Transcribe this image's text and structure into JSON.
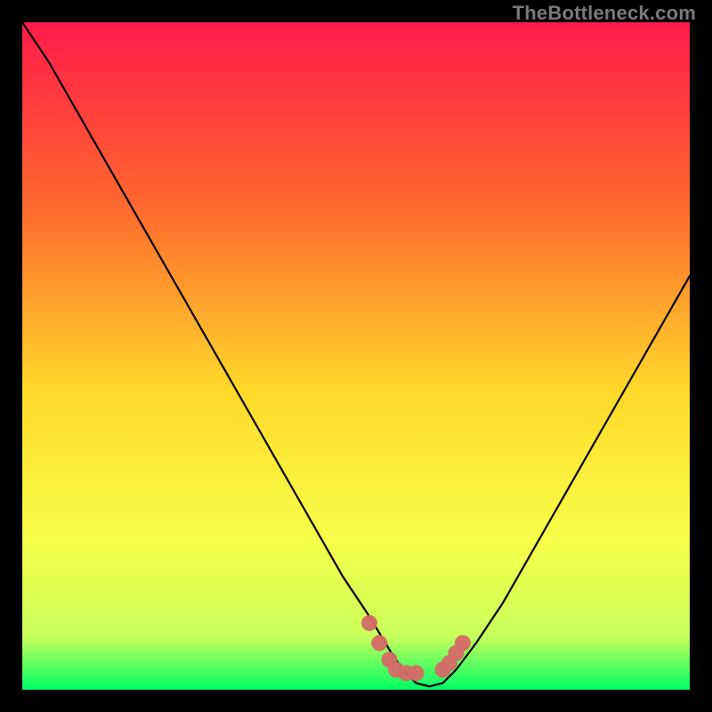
{
  "watermark": "TheBottleneck.com",
  "colors": {
    "background": "#000000",
    "gradient_top": "#ff1a4a",
    "gradient_mid_upper": "#ff8b2a",
    "gradient_mid": "#ffd82a",
    "gradient_mid_lower": "#f7ff4a",
    "gradient_lower": "#c8ff5a",
    "gradient_bottom": "#00ff66",
    "curve": "#000000",
    "marker": "#d46a66"
  },
  "chart_data": {
    "type": "line",
    "title": "",
    "xlabel": "",
    "ylabel": "",
    "xlim": [
      0,
      100
    ],
    "ylim": [
      0,
      100
    ],
    "series": [
      {
        "name": "bottleneck-curve",
        "x": [
          0,
          4,
          8,
          12,
          16,
          20,
          24,
          28,
          32,
          36,
          40,
          44,
          48,
          52,
          55,
          57,
          59,
          61,
          63,
          65,
          68,
          72,
          76,
          80,
          84,
          88,
          92,
          96,
          100
        ],
        "values": [
          100,
          94,
          87,
          80,
          73,
          66,
          59,
          52,
          45,
          38,
          31,
          24,
          17,
          11,
          6,
          3,
          1,
          0.5,
          1,
          3,
          7,
          13,
          20,
          27,
          34,
          41,
          48,
          55,
          62
        ]
      }
    ],
    "markers": [
      {
        "name": "left-marker-cluster",
        "points": [
          {
            "x": 52,
            "y": 10
          },
          {
            "x": 53.5,
            "y": 7
          },
          {
            "x": 55,
            "y": 4.5
          },
          {
            "x": 56,
            "y": 3
          },
          {
            "x": 57.5,
            "y": 2.5
          },
          {
            "x": 59,
            "y": 2.5
          }
        ]
      },
      {
        "name": "right-marker-cluster",
        "points": [
          {
            "x": 63,
            "y": 3
          },
          {
            "x": 64,
            "y": 4
          },
          {
            "x": 65,
            "y": 5.5
          },
          {
            "x": 66,
            "y": 7
          }
        ]
      }
    ]
  }
}
